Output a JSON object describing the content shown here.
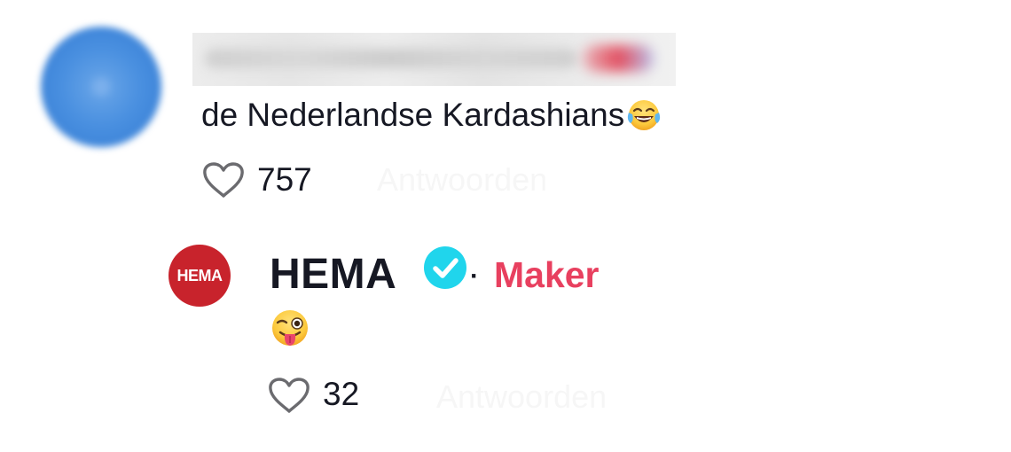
{
  "comment": {
    "text": "de Nederlandse Kardashians",
    "emoji": "face-with-tears-of-joy",
    "likes": "757",
    "reply_label": "Antwoorden"
  },
  "reply": {
    "avatar_text": "HEMA",
    "author": "HEMA",
    "verified": true,
    "separator": "·",
    "badge": "Maker",
    "emoji": "winking-face-with-tongue",
    "likes": "32",
    "reply_label": "Antwoorden"
  },
  "colors": {
    "text": "#161823",
    "creator_badge": "#e8405f",
    "verified": "#20d5ec",
    "hema_red": "#c8232c",
    "avatar_blue": "#4a90e0"
  }
}
